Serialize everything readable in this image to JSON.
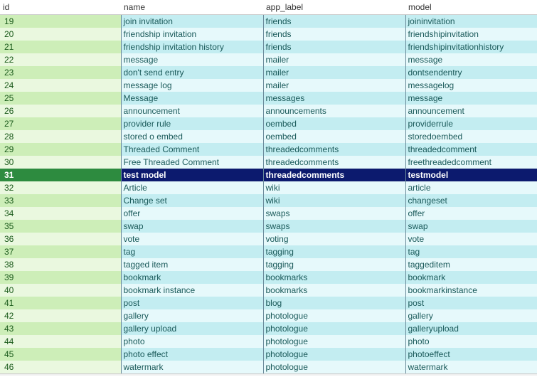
{
  "columns": {
    "id": "id",
    "name": "name",
    "app_label": "app_label",
    "model": "model"
  },
  "selected_id": 31,
  "rows": [
    {
      "id": 19,
      "name": "join invitation",
      "app_label": "friends",
      "model": "joininvitation"
    },
    {
      "id": 20,
      "name": "friendship invitation",
      "app_label": "friends",
      "model": "friendshipinvitation"
    },
    {
      "id": 21,
      "name": "friendship invitation history",
      "app_label": "friends",
      "model": "friendshipinvitationhistory"
    },
    {
      "id": 22,
      "name": "message",
      "app_label": "mailer",
      "model": "message"
    },
    {
      "id": 23,
      "name": "don't send entry",
      "app_label": "mailer",
      "model": "dontsendentry"
    },
    {
      "id": 24,
      "name": "message log",
      "app_label": "mailer",
      "model": "messagelog"
    },
    {
      "id": 25,
      "name": "Message",
      "app_label": "messages",
      "model": "message"
    },
    {
      "id": 26,
      "name": "announcement",
      "app_label": "announcements",
      "model": "announcement"
    },
    {
      "id": 27,
      "name": "provider rule",
      "app_label": "oembed",
      "model": "providerrule"
    },
    {
      "id": 28,
      "name": "stored o embed",
      "app_label": "oembed",
      "model": "storedoembed"
    },
    {
      "id": 29,
      "name": "Threaded Comment",
      "app_label": "threadedcomments",
      "model": "threadedcomment"
    },
    {
      "id": 30,
      "name": "Free Threaded Comment",
      "app_label": "threadedcomments",
      "model": "freethreadedcomment"
    },
    {
      "id": 31,
      "name": "test model",
      "app_label": "threadedcomments",
      "model": "testmodel"
    },
    {
      "id": 32,
      "name": "Article",
      "app_label": "wiki",
      "model": "article"
    },
    {
      "id": 33,
      "name": "Change set",
      "app_label": "wiki",
      "model": "changeset"
    },
    {
      "id": 34,
      "name": "offer",
      "app_label": "swaps",
      "model": "offer"
    },
    {
      "id": 35,
      "name": "swap",
      "app_label": "swaps",
      "model": "swap"
    },
    {
      "id": 36,
      "name": "vote",
      "app_label": "voting",
      "model": "vote"
    },
    {
      "id": 37,
      "name": "tag",
      "app_label": "tagging",
      "model": "tag"
    },
    {
      "id": 38,
      "name": "tagged item",
      "app_label": "tagging",
      "model": "taggeditem"
    },
    {
      "id": 39,
      "name": "bookmark",
      "app_label": "bookmarks",
      "model": "bookmark"
    },
    {
      "id": 40,
      "name": "bookmark instance",
      "app_label": "bookmarks",
      "model": "bookmarkinstance"
    },
    {
      "id": 41,
      "name": "post",
      "app_label": "blog",
      "model": "post"
    },
    {
      "id": 42,
      "name": "gallery",
      "app_label": "photologue",
      "model": "gallery"
    },
    {
      "id": 43,
      "name": "gallery upload",
      "app_label": "photologue",
      "model": "galleryupload"
    },
    {
      "id": 44,
      "name": "photo",
      "app_label": "photologue",
      "model": "photo"
    },
    {
      "id": 45,
      "name": "photo effect",
      "app_label": "photologue",
      "model": "photoeffect"
    },
    {
      "id": 46,
      "name": "watermark",
      "app_label": "photologue",
      "model": "watermark"
    }
  ]
}
